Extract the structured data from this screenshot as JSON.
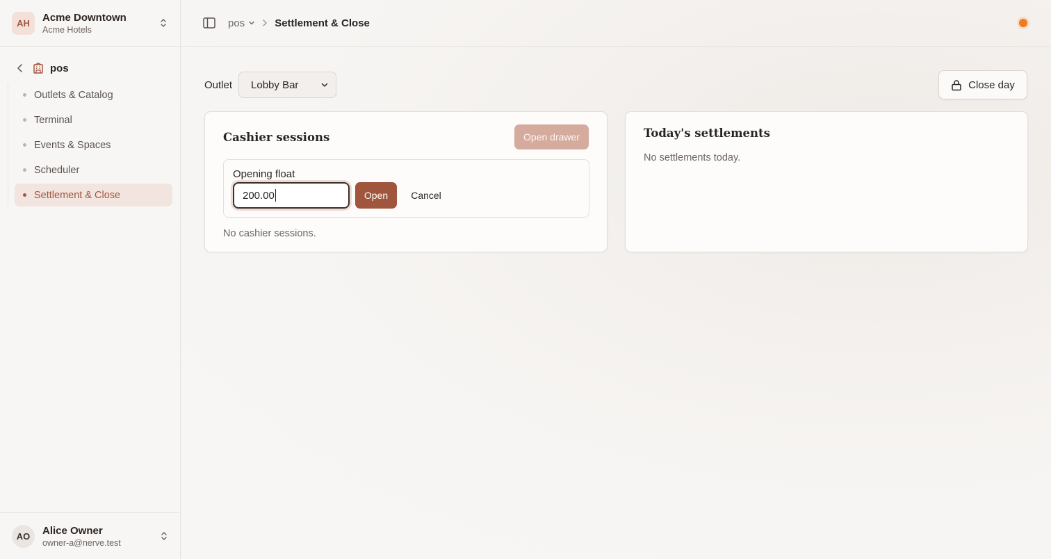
{
  "org": {
    "initials": "AH",
    "name": "Acme Downtown",
    "subtitle": "Acme Hotels"
  },
  "nav": {
    "title": "pos",
    "items": [
      {
        "label": "Outlets & Catalog",
        "active": false
      },
      {
        "label": "Terminal",
        "active": false
      },
      {
        "label": "Events & Spaces",
        "active": false
      },
      {
        "label": "Scheduler",
        "active": false
      },
      {
        "label": "Settlement & Close",
        "active": true
      }
    ]
  },
  "user": {
    "initials": "AO",
    "name": "Alice Owner",
    "email": "owner-a@nerve.test"
  },
  "breadcrumb": {
    "module": "pos",
    "current": "Settlement & Close"
  },
  "status_color": "#f07a1e",
  "filter": {
    "label": "Outlet",
    "selected": "Lobby Bar"
  },
  "close_day_label": "Close day",
  "cashier": {
    "title": "Cashier sessions",
    "open_drawer_label": "Open drawer",
    "float_label": "Opening float",
    "float_value": "200.00",
    "open_label": "Open",
    "cancel_label": "Cancel",
    "empty_text": "No cashier sessions."
  },
  "settlements": {
    "title": "Today's settlements",
    "empty_text": "No settlements today."
  },
  "colors": {
    "accent": "#a0563d",
    "accent_soft": "#d4ab9d",
    "active_bg": "#f2e4de"
  }
}
